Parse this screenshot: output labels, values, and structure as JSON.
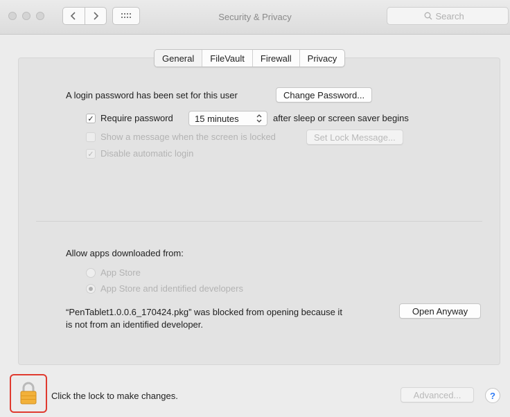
{
  "window": {
    "title": "Security & Privacy",
    "search_placeholder": "Search"
  },
  "tabs": [
    {
      "label": "General",
      "active": true
    },
    {
      "label": "FileVault",
      "active": false
    },
    {
      "label": "Firewall",
      "active": false
    },
    {
      "label": "Privacy",
      "active": false
    }
  ],
  "general": {
    "login_password_text": "A login password has been set for this user",
    "change_password_label": "Change Password...",
    "require_password_label": "Require password",
    "require_password_checked": true,
    "require_password_delay": "15 minutes",
    "require_password_suffix": "after sleep or screen saver begins",
    "show_message_label": "Show a message when the screen is locked",
    "show_message_checked": false,
    "set_lock_message_label": "Set Lock Message...",
    "disable_auto_login_label": "Disable automatic login",
    "disable_auto_login_checked": true
  },
  "downloads": {
    "heading": "Allow apps downloaded from:",
    "options": [
      {
        "label": "App Store",
        "selected": false
      },
      {
        "label": "App Store and identified developers",
        "selected": true
      }
    ],
    "blocked_line1": "“PenTablet1.0.0.6_170424.pkg” was blocked from opening because it",
    "blocked_line2": "is not from an identified developer.",
    "open_anyway_label": "Open Anyway"
  },
  "footer": {
    "lock_text": "Click the lock to make changes.",
    "advanced_label": "Advanced...",
    "help_label": "?"
  },
  "colors": {
    "highlight": "#e03a2f",
    "lock_body": "#f2b13a",
    "help_accent": "#2f7bf5"
  }
}
